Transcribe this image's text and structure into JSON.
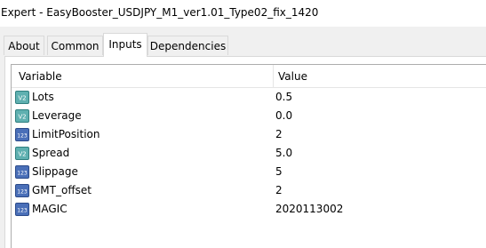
{
  "window": {
    "title": "Expert - EasyBooster_USDJPY_M1_ver1.01_Type02_fix_1420"
  },
  "tabs": [
    {
      "label": "About"
    },
    {
      "label": "Common"
    },
    {
      "label": "Inputs",
      "active": true
    },
    {
      "label": "Dependencies"
    }
  ],
  "table": {
    "headers": {
      "variable": "Variable",
      "value": "Value"
    },
    "rows": [
      {
        "name": "Lots",
        "value": "0.5",
        "icon": "double-type-icon"
      },
      {
        "name": "Leverage",
        "value": "0.0",
        "icon": "double-type-icon"
      },
      {
        "name": "LimitPosition",
        "value": "2",
        "icon": "integer-type-icon"
      },
      {
        "name": "Spread",
        "value": "5.0",
        "icon": "double-type-icon"
      },
      {
        "name": "Slippage",
        "value": "5",
        "icon": "integer-type-icon"
      },
      {
        "name": "GMT_offset",
        "value": "2",
        "icon": "integer-type-icon"
      },
      {
        "name": "MAGIC",
        "value": "2020113002",
        "icon": "integer-type-icon"
      }
    ]
  },
  "colors": {
    "double_icon": "#4a9e9e",
    "integer_icon": "#3a5ea8"
  }
}
